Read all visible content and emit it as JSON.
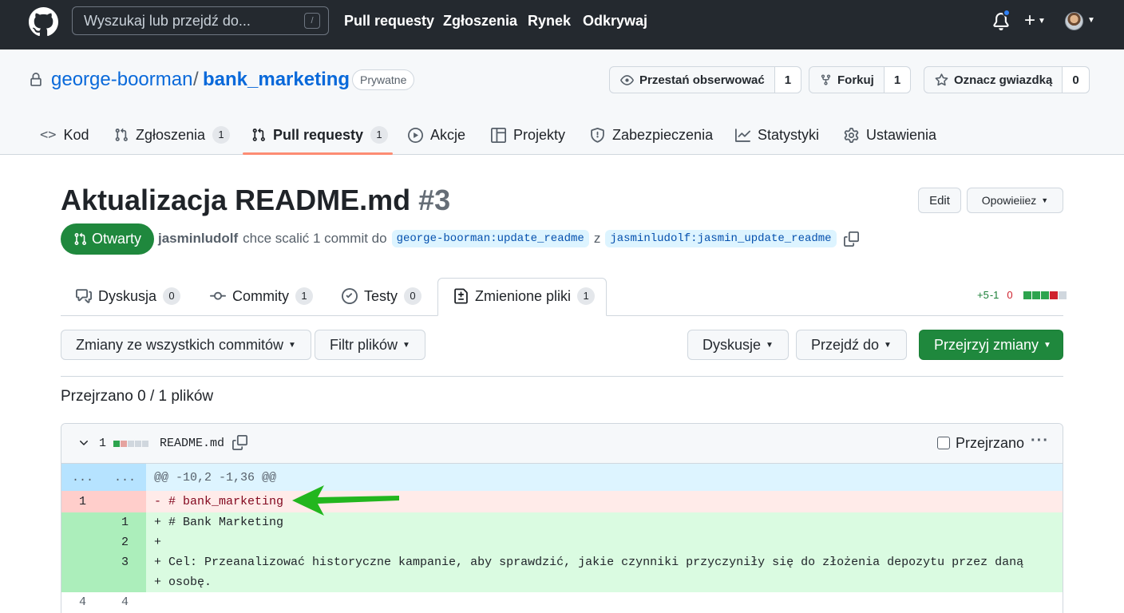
{
  "topnav": {
    "search_placeholder": "Wyszukaj lub przejdź do...",
    "search_shortcut": "/",
    "links": [
      "Pull requesty",
      "Zgłoszenia",
      "Rynek",
      "Odkrywaj"
    ]
  },
  "repo": {
    "owner": "george-boorman",
    "separator": "/",
    "name": "bank_marketing",
    "visibility": "Prywatne",
    "watch_label": "Przestań obserwować",
    "watch_count": "1",
    "fork_label": "Forkuj",
    "fork_count": "1",
    "star_label": "Oznacz gwiazdką",
    "star_count": "0"
  },
  "repo_tabs": [
    {
      "label": "Kod"
    },
    {
      "label": "Zgłoszenia",
      "count": "1"
    },
    {
      "label": "Pull requesty",
      "count": "1"
    },
    {
      "label": "Akcje"
    },
    {
      "label": "Projekty"
    },
    {
      "label": "Zabezpieczenia"
    },
    {
      "label": "Statystyki"
    },
    {
      "label": "Ustawienia"
    }
  ],
  "pr": {
    "title": "Aktualizacja README.md",
    "number": "#3",
    "edit_label": "Edit",
    "code_label": "Opowieiiez",
    "status": "Otwarty",
    "author": "jasminludolf",
    "action_text": "chce scalić 1 commit do",
    "base_branch": "george-boorman:update_readme",
    "conj": "z",
    "head_branch": "jasminludolf:jasmin_update_readme"
  },
  "pr_tabs": [
    {
      "label": "Dyskusja",
      "count": "0"
    },
    {
      "label": "Commity",
      "count": "1"
    },
    {
      "label": "Testy",
      "count": "0"
    },
    {
      "label": "Zmienione pliki",
      "count": "1"
    }
  ],
  "diffstat": {
    "additions": "+5",
    "minus": "-1",
    "zero": "0"
  },
  "toolbar": {
    "commits_filter": "Zmiany ze wszystkich commitów",
    "file_filter": "Filtr plików",
    "discussions": "Dyskusje",
    "jump_to": "Przejdź do",
    "review": "Przejrzyj zmiany"
  },
  "reviewed_summary": "Przejrzano 0 / 1 plików",
  "file": {
    "changes": "1",
    "name": "README.md",
    "viewed_label": "Przejrzano",
    "more": "···"
  },
  "diff": {
    "hunk": "@@ -10,2 -1,36 @@",
    "hunk_left": "...",
    "hunk_right": "...",
    "rows": [
      {
        "type": "del",
        "old": "1",
        "new": "",
        "code": "- # bank_marketing"
      },
      {
        "type": "add",
        "old": "",
        "new": "1",
        "code": "+ # Bank Marketing"
      },
      {
        "type": "add",
        "old": "",
        "new": "2",
        "code": "+"
      },
      {
        "type": "add",
        "old": "",
        "new": "3",
        "code": "+ Cel: Przeanalizować historyczne kampanie, aby sprawdzić, jakie czynniki przyczyniły się do złożenia depozytu przez daną"
      },
      {
        "type": "add",
        "old": "",
        "new": "",
        "code": "+ osobę."
      },
      {
        "type": "ctx",
        "old": "4",
        "new": "4",
        "code": ""
      }
    ]
  },
  "colors": {
    "header_bg": "#24292f",
    "accent_link": "#0969da",
    "success_green": "#1f883d",
    "annotation_arrow": "#22b61e",
    "tab_underline": "#fd8c73"
  }
}
